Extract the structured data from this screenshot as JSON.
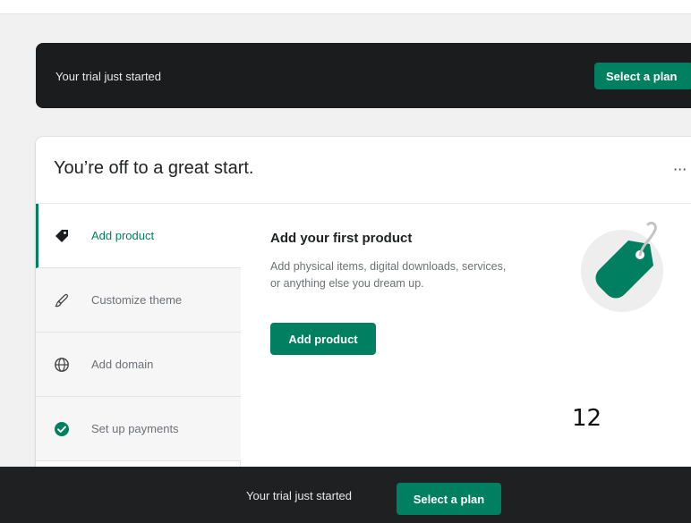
{
  "top_banner": {
    "text": "Your trial just started",
    "button_label": "Select a plan"
  },
  "setup_card": {
    "title": "You’re off to a great start.",
    "more_label": "···",
    "tasks": [
      {
        "label": "Add product",
        "icon": "tag-icon",
        "active": true
      },
      {
        "label": "Customize theme",
        "icon": "brush-icon",
        "active": false
      },
      {
        "label": "Add domain",
        "icon": "globe-icon",
        "active": false
      },
      {
        "label": "Set up payments",
        "icon": "check-circle-icon",
        "active": false
      }
    ],
    "detail": {
      "title": "Add your first product",
      "description": "Add physical items, digital downloads, services, or anything else you dream up.",
      "button_label": "Add product",
      "illustration": "price-tag-illustration"
    }
  },
  "page_number": "12",
  "bottom_bar": {
    "text": "Your trial just started",
    "button_label": "Select a plan"
  },
  "colors": {
    "accent": "#008060",
    "dark_bar": "#1a1c1d",
    "muted_text": "#6d7175"
  }
}
